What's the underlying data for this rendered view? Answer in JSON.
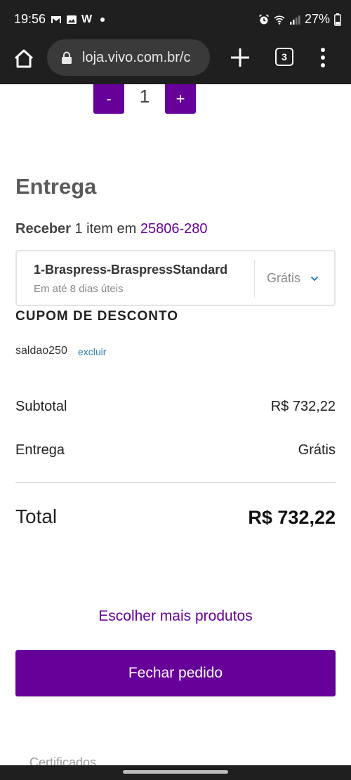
{
  "status_bar": {
    "time": "19:56",
    "battery": "27%",
    "app_letter": "W"
  },
  "browser": {
    "url": "loja.vivo.com.br/c",
    "tab_count": "3"
  },
  "cart": {
    "quantity_minus": "-",
    "quantity_value": "1",
    "quantity_plus": "+"
  },
  "delivery": {
    "title": "Entrega",
    "receive_prefix": "Receber",
    "receive_middle": " 1 item em ",
    "cep": "25806-280",
    "shipping_name": "1-Braspress-BraspressStandard",
    "shipping_eta": "Em até 8 dias úteis",
    "shipping_price": "Grátis"
  },
  "coupon": {
    "title": "CUPOM DE DESCONTO",
    "code": "saldao250",
    "remove_label": "excluir"
  },
  "summary": {
    "subtotal_label": "Subtotal",
    "subtotal_value": "R$ 732,22",
    "delivery_label": "Entrega",
    "delivery_value": "Grátis",
    "total_label": "Total",
    "total_value": "R$ 732,22"
  },
  "actions": {
    "more_products": "Escolher mais produtos",
    "checkout": "Fechar pedido"
  },
  "footer": {
    "certificates": "Certificados"
  },
  "colors": {
    "brand": "#660099",
    "link": "#2d7fb3",
    "bar": "#1f1f1f"
  }
}
